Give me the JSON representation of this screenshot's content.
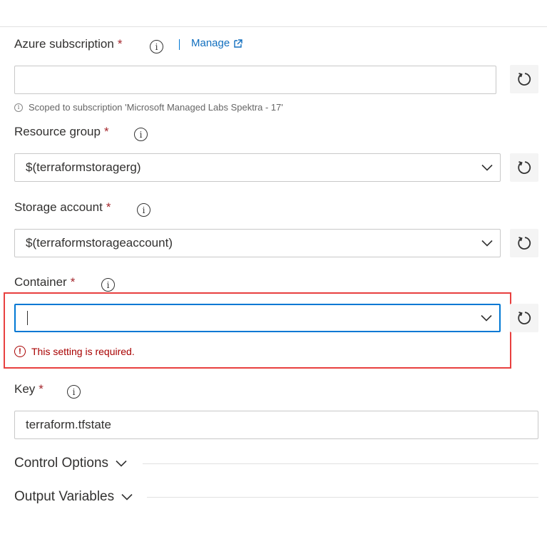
{
  "subscription": {
    "label": "Azure subscription",
    "required_mark": "*",
    "separator": "|",
    "manage_label": "Manage",
    "value": "",
    "hint": "Scoped to subscription 'Microsoft Managed Labs Spektra - 17'"
  },
  "resource_group": {
    "label": "Resource group",
    "required_mark": "*",
    "value": "$(terraformstoragerg)"
  },
  "storage_account": {
    "label": "Storage account",
    "required_mark": "*",
    "value": "$(terraformstorageaccount)"
  },
  "container": {
    "label": "Container",
    "required_mark": "*",
    "value": "",
    "error": "This setting is required."
  },
  "key": {
    "label": "Key",
    "required_mark": "*",
    "value": "terraform.tfstate"
  },
  "sections": {
    "control_options": "Control Options",
    "output_variables": "Output Variables"
  },
  "icons": {
    "info": "info-icon",
    "refresh": "refresh-icon",
    "chevron": "chevron-down-icon",
    "external": "external-link-icon",
    "error": "error-icon"
  },
  "colors": {
    "accent": "#0078d4",
    "link": "#106ebe",
    "required": "#a4262c",
    "error": "#a80000",
    "highlight": "#e8403f"
  }
}
